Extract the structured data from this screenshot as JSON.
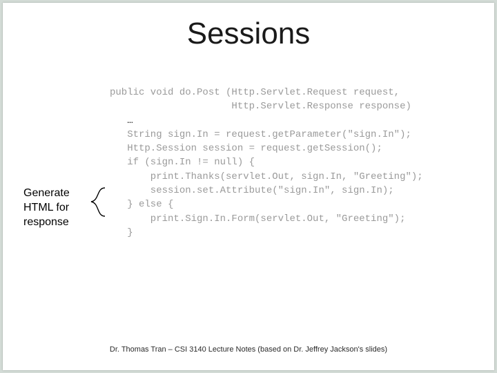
{
  "title": "Sessions",
  "code": {
    "l1": "public void do.Post (Http.Servlet.Request request,",
    "l2": "                     Http.Servlet.Response response)",
    "l3_pre": "   ",
    "l3_ellipsis": "…",
    "l4": "   String sign.In = request.getParameter(\"sign.In\");",
    "l5": "   Http.Session session = request.getSession();",
    "l6": "   if (sign.In != null) {",
    "l7": "       print.Thanks(servlet.Out, sign.In, \"Greeting\");",
    "l8": "       session.set.Attribute(\"sign.In\", sign.In);",
    "l9": "   } else {",
    "l10": "       print.Sign.In.Form(servlet.Out, \"Greeting\");",
    "l11": "   }"
  },
  "annotation": {
    "line1": "Generate",
    "line2": "HTML for",
    "line3": "response"
  },
  "footer": "Dr. Thomas Tran – CSI 3140 Lecture Notes (based on Dr. Jeffrey Jackson's slides)"
}
